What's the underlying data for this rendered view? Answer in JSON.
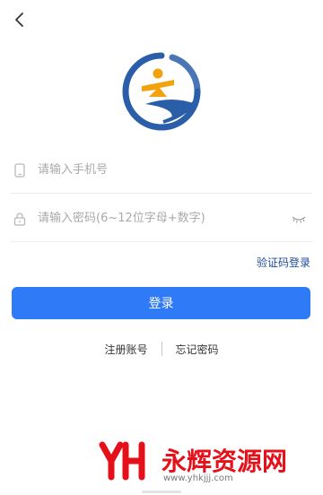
{
  "nav": {
    "back_icon": "chevron-left-icon"
  },
  "logo": {
    "icon": "app-logo",
    "colors": {
      "blue": "#2b5ea8",
      "orange": "#f2a20c"
    }
  },
  "form": {
    "phone": {
      "icon": "phone-icon",
      "placeholder": "请输入手机号",
      "value": ""
    },
    "password": {
      "icon": "lock-icon",
      "placeholder": "请输入密码(6~12位字母+数字)",
      "value": "",
      "toggle_icon": "eye-closed-icon"
    },
    "code_login_label": "验证码登录",
    "login_label": "登录"
  },
  "links": {
    "register_label": "注册账号",
    "forgot_label": "忘记密码"
  },
  "watermark": {
    "text": "永辉资源网",
    "url": "www.yhkjjj.com"
  },
  "colors": {
    "accent": "#2f7af7",
    "link": "#1f4b9a",
    "watermark": "#e5101a"
  }
}
